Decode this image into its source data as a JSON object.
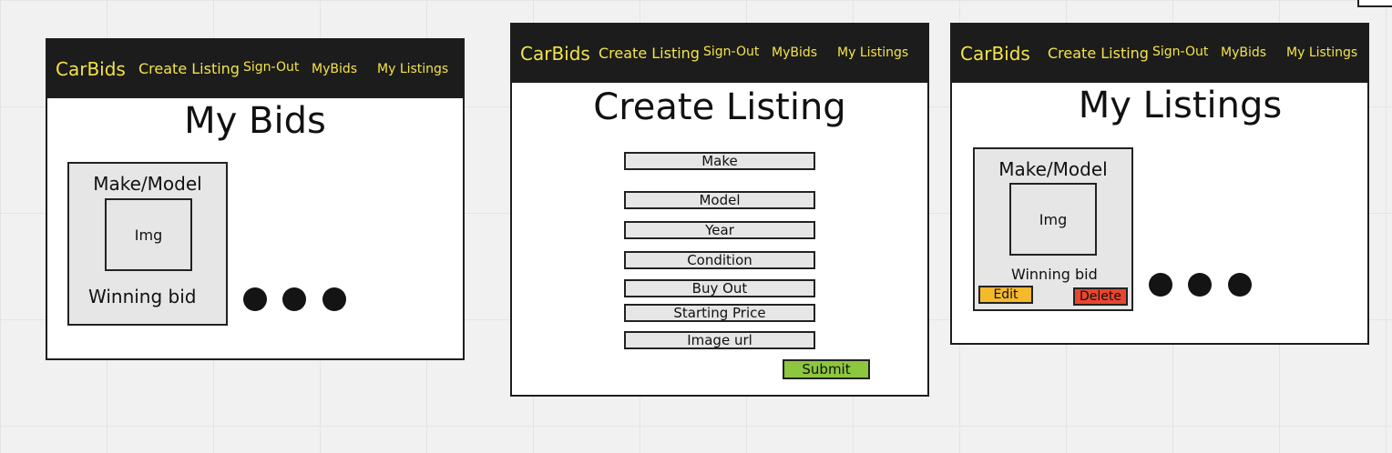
{
  "nav": {
    "brand": "CarBids",
    "create_listing": "Create Listing",
    "sign_out": "Sign-Out",
    "my_bids": "MyBids",
    "my_listings": "My Listings"
  },
  "colors": {
    "navbar_bg": "#1c1c1c",
    "nav_text": "#f3e34a",
    "card_bg": "#e6e6e6",
    "submit": "#8dc63f",
    "edit": "#f5b92c",
    "delete": "#e8462f"
  },
  "my_bids": {
    "title": "My Bids",
    "card": {
      "title": "Make/Model",
      "img": "Img",
      "bid_label": "Winning bid"
    }
  },
  "create_listing": {
    "title": "Create Listing",
    "fields": {
      "make": "Make",
      "model": "Model",
      "year": "Year",
      "condition": "Condition",
      "buy_out": "Buy Out",
      "starting_price": "Starting Price",
      "image_url": "Image url"
    },
    "submit": "Submit"
  },
  "my_listings": {
    "title": "My Listings",
    "card": {
      "title": "Make/Model",
      "img": "Img",
      "bid_label": "Winning bid",
      "edit": "Edit",
      "delete": "Delete"
    }
  }
}
